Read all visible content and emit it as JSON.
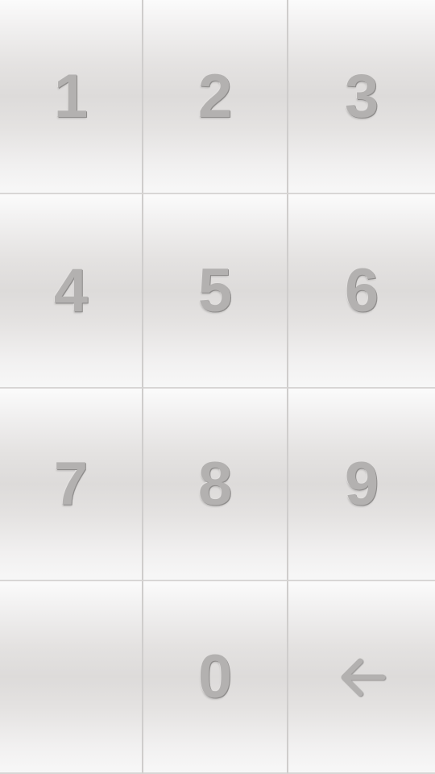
{
  "keypad": {
    "keys": [
      {
        "label": "1"
      },
      {
        "label": "2"
      },
      {
        "label": "3"
      },
      {
        "label": "4"
      },
      {
        "label": "5"
      },
      {
        "label": "6"
      },
      {
        "label": "7"
      },
      {
        "label": "8"
      },
      {
        "label": "9"
      },
      {
        "label": ""
      },
      {
        "label": "0"
      },
      {
        "icon": "backspace-arrow-icon"
      }
    ]
  },
  "colors": {
    "key_face": "#dddbda",
    "key_highlight": "#fbfbfb",
    "digit": "#b3b1b0",
    "digit_shadow": "#8e8c8b",
    "divider": "#cfcdcc"
  }
}
